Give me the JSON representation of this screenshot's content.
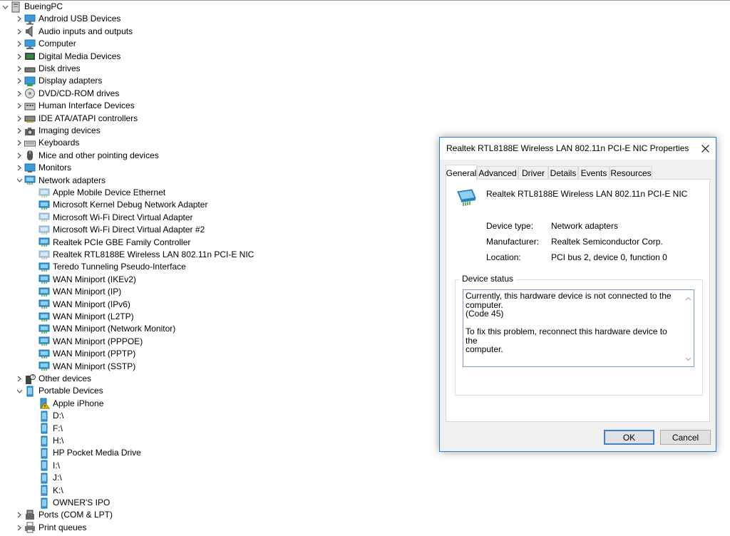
{
  "tree": {
    "root": "BueingPC",
    "categories": [
      {
        "label": "Android USB Devices",
        "icon": "usb-device-icon",
        "expanded": false
      },
      {
        "label": "Audio inputs and outputs",
        "icon": "speaker-icon",
        "expanded": false
      },
      {
        "label": "Computer",
        "icon": "computer-icon",
        "expanded": false
      },
      {
        "label": "Digital Media Devices",
        "icon": "media-device-icon",
        "expanded": false
      },
      {
        "label": "Disk drives",
        "icon": "disk-drive-icon",
        "expanded": false
      },
      {
        "label": "Display adapters",
        "icon": "display-adapter-icon",
        "expanded": false
      },
      {
        "label": "DVD/CD-ROM drives",
        "icon": "dvd-drive-icon",
        "expanded": false
      },
      {
        "label": "Human Interface Devices",
        "icon": "hid-icon",
        "expanded": false
      },
      {
        "label": "IDE ATA/ATAPI controllers",
        "icon": "ide-controller-icon",
        "expanded": false
      },
      {
        "label": "Imaging devices",
        "icon": "camera-icon",
        "expanded": false
      },
      {
        "label": "Keyboards",
        "icon": "keyboard-icon",
        "expanded": false
      },
      {
        "label": "Mice and other pointing devices",
        "icon": "mouse-icon",
        "expanded": false
      },
      {
        "label": "Monitors",
        "icon": "monitor-icon",
        "expanded": false
      },
      {
        "label": "Network adapters",
        "icon": "network-adapter-icon",
        "expanded": true
      }
    ],
    "network_adapters": [
      {
        "label": "Apple Mobile Device Ethernet",
        "dim": true
      },
      {
        "label": "Microsoft Kernel Debug Network Adapter",
        "dim": false
      },
      {
        "label": "Microsoft Wi-Fi Direct Virtual Adapter",
        "dim": true
      },
      {
        "label": "Microsoft Wi-Fi Direct Virtual Adapter #2",
        "dim": true
      },
      {
        "label": "Realtek PCIe GBE Family Controller",
        "dim": false
      },
      {
        "label": "Realtek RTL8188E Wireless LAN 802.11n PCI-E NIC",
        "dim": true
      },
      {
        "label": "Teredo Tunneling Pseudo-Interface",
        "dim": false
      },
      {
        "label": "WAN Miniport (IKEv2)",
        "dim": false
      },
      {
        "label": "WAN Miniport (IP)",
        "dim": false
      },
      {
        "label": "WAN Miniport (IPv6)",
        "dim": false
      },
      {
        "label": "WAN Miniport (L2TP)",
        "dim": false
      },
      {
        "label": "WAN Miniport (Network Monitor)",
        "dim": false
      },
      {
        "label": "WAN Miniport (PPPOE)",
        "dim": false
      },
      {
        "label": "WAN Miniport (PPTP)",
        "dim": false
      },
      {
        "label": "WAN Miniport (SSTP)",
        "dim": false
      }
    ],
    "other_devices": "Other devices",
    "portable_devices": "Portable Devices",
    "portable_children": [
      {
        "label": "Apple iPhone",
        "warning": true
      },
      {
        "label": "D:\\",
        "warning": false
      },
      {
        "label": "F:\\",
        "warning": false
      },
      {
        "label": "H:\\",
        "warning": false
      },
      {
        "label": "HP Pocket Media Drive",
        "warning": false
      },
      {
        "label": "I:\\",
        "warning": false
      },
      {
        "label": "J:\\",
        "warning": false
      },
      {
        "label": "K:\\",
        "warning": false
      },
      {
        "label": "OWNER'S IPO",
        "warning": false
      }
    ],
    "after": [
      {
        "label": "Ports (COM & LPT)",
        "icon": "port-icon"
      },
      {
        "label": "Print queues",
        "icon": "printer-icon"
      }
    ]
  },
  "dialog": {
    "title": "Realtek RTL8188E Wireless LAN 802.11n PCI-E NIC Properties",
    "tabs": [
      "General",
      "Advanced",
      "Driver",
      "Details",
      "Events",
      "Resources"
    ],
    "active_tab": "General",
    "device_name": "Realtek RTL8188E Wireless LAN 802.11n PCI-E NIC",
    "props": [
      {
        "label": "Device type:",
        "value": "Network adapters"
      },
      {
        "label": "Manufacturer:",
        "value": "Realtek Semiconductor Corp."
      },
      {
        "label": "Location:",
        "value": "PCI bus 2, device 0, function 0"
      }
    ],
    "status_title": "Device status",
    "status_lines": [
      "Currently, this hardware device is not connected to the computer.",
      "(Code 45)",
      "",
      "To fix this problem, reconnect this hardware device to the",
      "computer."
    ],
    "ok_label": "OK",
    "cancel_label": "Cancel"
  },
  "colors": {
    "accent": "#0078d7",
    "dialog_border": "#2b7bd1",
    "dim_icon": "#a9c7de"
  }
}
